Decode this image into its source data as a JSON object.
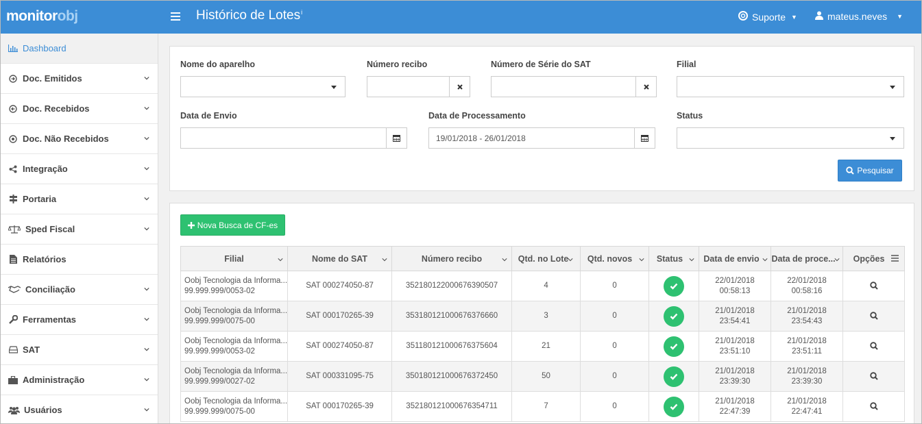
{
  "header": {
    "logo_main": "monitor",
    "logo_accent": "obj",
    "title": "Histórico de Lotes",
    "title_info": "i",
    "support_label": "Suporte",
    "user_label": "mateus.neves"
  },
  "sidebar": {
    "items": [
      {
        "label": "Dashboard",
        "icon": "bar-chart-icon"
      },
      {
        "label": "Doc. Emitidos",
        "icon": "arrow-circle-right-icon"
      },
      {
        "label": "Doc. Recebidos",
        "icon": "arrow-circle-left-icon"
      },
      {
        "label": "Doc. Não Recebidos",
        "icon": "dot-circle-icon"
      },
      {
        "label": "Integração",
        "icon": "share-icon"
      },
      {
        "label": "Portaria",
        "icon": "signpost-icon"
      },
      {
        "label": "Sped Fiscal",
        "icon": "balance-scale-icon"
      },
      {
        "label": "Relatórios",
        "icon": "file-text-icon"
      },
      {
        "label": "Conciliação",
        "icon": "handshake-icon"
      },
      {
        "label": "Ferramentas",
        "icon": "wrench-icon"
      },
      {
        "label": "SAT",
        "icon": "hdd-icon"
      },
      {
        "label": "Administração",
        "icon": "briefcase-icon"
      },
      {
        "label": "Usuários",
        "icon": "users-icon"
      }
    ]
  },
  "filters": {
    "nome_aparelho_label": "Nome do aparelho",
    "nome_aparelho_value": "",
    "numero_recibo_label": "Número recibo",
    "numero_recibo_value": "",
    "numero_serie_label": "Número de Série do SAT",
    "numero_serie_value": "",
    "filial_label": "Filial",
    "filial_value": "",
    "data_envio_label": "Data de Envio",
    "data_envio_value": "",
    "data_processamento_label": "Data de Processamento",
    "data_processamento_value": "19/01/2018 - 26/01/2018",
    "status_label": "Status",
    "status_value": "",
    "search_button": "Pesquisar"
  },
  "results": {
    "new_search_button": "Nova Busca de CF-es",
    "columns": [
      "Filial",
      "Nome do SAT",
      "Número recibo",
      "Qtd. no Lote",
      "Qtd. novos",
      "Status",
      "Data de envio",
      "Data de proce...",
      "Opções"
    ],
    "rows": [
      {
        "filial_name": "Oobj Tecnologia da Informa...",
        "filial_cnpj": "99.999.999/0053-02",
        "sat": "SAT 000274050-87",
        "recibo": "352180122000676390507",
        "qtd_lote": "4",
        "qtd_novos": "0",
        "status": "ok",
        "envio_date": "22/01/2018",
        "envio_time": "00:58:13",
        "proc_date": "22/01/2018",
        "proc_time": "00:58:16"
      },
      {
        "filial_name": "Oobj Tecnologia da Informa...",
        "filial_cnpj": "99.999.999/0075-00",
        "sat": "SAT 000170265-39",
        "recibo": "353180121000676376660",
        "qtd_lote": "3",
        "qtd_novos": "0",
        "status": "ok",
        "envio_date": "21/01/2018",
        "envio_time": "23:54:41",
        "proc_date": "21/01/2018",
        "proc_time": "23:54:43"
      },
      {
        "filial_name": "Oobj Tecnologia da Informa...",
        "filial_cnpj": "99.999.999/0053-02",
        "sat": "SAT 000274050-87",
        "recibo": "351180121000676375604",
        "qtd_lote": "21",
        "qtd_novos": "0",
        "status": "ok",
        "envio_date": "21/01/2018",
        "envio_time": "23:51:10",
        "proc_date": "21/01/2018",
        "proc_time": "23:51:11"
      },
      {
        "filial_name": "Oobj Tecnologia da Informa...",
        "filial_cnpj": "99.999.999/0027-02",
        "sat": "SAT 000331095-75",
        "recibo": "350180121000676372450",
        "qtd_lote": "50",
        "qtd_novos": "0",
        "status": "ok",
        "envio_date": "21/01/2018",
        "envio_time": "23:39:30",
        "proc_date": "21/01/2018",
        "proc_time": "23:39:30"
      },
      {
        "filial_name": "Oobj Tecnologia da Informa...",
        "filial_cnpj": "99.999.999/0075-00",
        "sat": "SAT 000170265-39",
        "recibo": "352180121000676354711",
        "qtd_lote": "7",
        "qtd_novos": "0",
        "status": "ok",
        "envio_date": "21/01/2018",
        "envio_time": "22:47:39",
        "proc_date": "21/01/2018",
        "proc_time": "22:47:41"
      }
    ]
  },
  "colors": {
    "primary": "#3c8dd6",
    "success": "#2ec171",
    "sidebar_bg": "#ffffff",
    "page_bg": "#f1f1f1"
  }
}
